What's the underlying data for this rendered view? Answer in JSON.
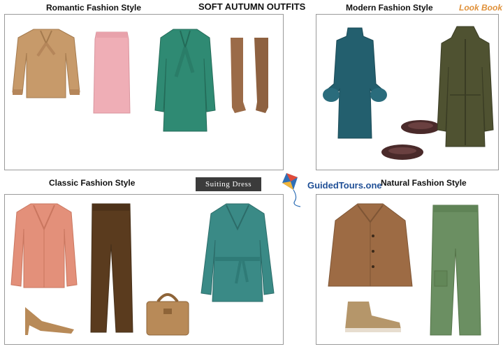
{
  "title": "SOFT AUTUMN OUTFITS",
  "lookbook": "Look Book",
  "badge": "Suiting Dress",
  "brand": "GuidedTours.one",
  "sections": {
    "romantic": {
      "heading": "Romantic Fashion Style",
      "items": [
        "camel-bow-blouse",
        "pink-pencil-skirt",
        "teal-bow-coat",
        "brown-suede-boots"
      ]
    },
    "modern": {
      "heading": "Modern Fashion Style",
      "items": [
        "teal-puff-sleeve-dress",
        "burgundy-loafers",
        "olive-parka"
      ]
    },
    "classic": {
      "heading": "Classic Fashion Style",
      "items": [
        "coral-cardigan",
        "brown-trousers",
        "tan-heels",
        "tan-tote-bag",
        "teal-wrap-coat"
      ]
    },
    "natural": {
      "heading": "Natural Fashion Style",
      "items": [
        "camel-cape-jacket",
        "green-cargo-pants",
        "tan-high-top-sneaker"
      ]
    }
  },
  "colors": {
    "camel": "#c79a6a",
    "pink": "#efaeb6",
    "teal": "#2f8a73",
    "suede": "#9b6b48",
    "petrol": "#235f6e",
    "olive": "#4f5231",
    "burgundy": "#4a2a2a",
    "coral": "#e3907a",
    "chocolate": "#5a3b1e",
    "tan": "#b88a58",
    "teal_coat": "#3a8a86",
    "cape": "#9d6b44",
    "green": "#6b8f62",
    "lookbook": "#e0913a",
    "brand": "#1f4f96"
  }
}
